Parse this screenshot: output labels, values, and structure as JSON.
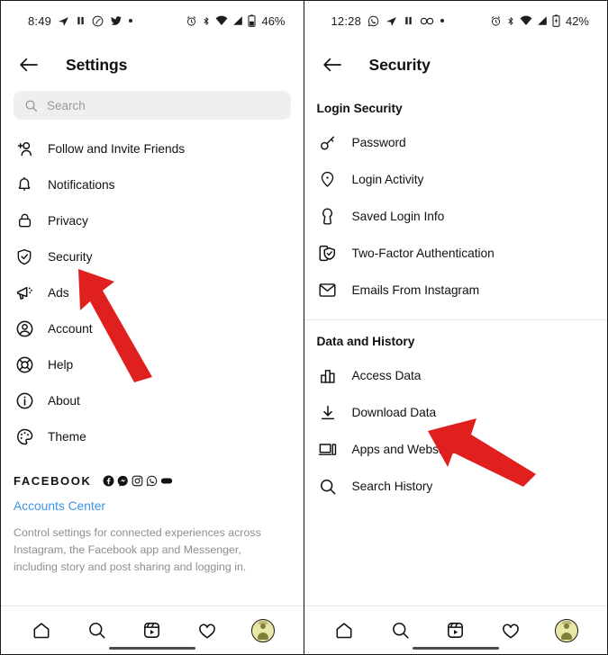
{
  "left_panel": {
    "status_bar": {
      "time": "8:49",
      "battery_percent": "46%",
      "left_icons": [
        "telegram-icon",
        "pause-icon",
        "spotify-icon",
        "twitter-icon",
        "more-dot-icon"
      ],
      "right_icons": [
        "alarm-icon",
        "bluetooth-icon",
        "wifi-icon",
        "signal-icon",
        "battery-icon"
      ]
    },
    "header": {
      "back_icon": "back-arrow-icon",
      "title": "Settings"
    },
    "search": {
      "icon": "search-icon",
      "placeholder": "Search",
      "value": ""
    },
    "items": [
      {
        "icon": "person-add-icon",
        "label": "Follow and Invite Friends"
      },
      {
        "icon": "bell-icon",
        "label": "Notifications"
      },
      {
        "icon": "lock-icon",
        "label": "Privacy"
      },
      {
        "icon": "shield-check-icon",
        "label": "Security"
      },
      {
        "icon": "megaphone-icon",
        "label": "Ads"
      },
      {
        "icon": "account-circle-icon",
        "label": "Account"
      },
      {
        "icon": "lifebuoy-icon",
        "label": "Help"
      },
      {
        "icon": "info-circle-icon",
        "label": "About"
      },
      {
        "icon": "palette-icon",
        "label": "Theme"
      }
    ],
    "facebook_block": {
      "brand": "FACEBOOK",
      "brand_icons": [
        "facebook-icon",
        "messenger-icon",
        "instagram-icon",
        "whatsapp-icon",
        "portal-icon"
      ],
      "link": "Accounts Center",
      "link_color": "#3f93e8",
      "description": "Control settings for connected experiences across Instagram, the Facebook app and Messenger, including story and post sharing and logging in."
    },
    "bottom_nav": [
      {
        "icon": "home-icon",
        "label": "Home"
      },
      {
        "icon": "search-icon",
        "label": "Search"
      },
      {
        "icon": "reels-icon",
        "label": "Reels"
      },
      {
        "icon": "heart-icon",
        "label": "Activity"
      },
      {
        "icon": "avatar-icon",
        "label": "Profile"
      }
    ]
  },
  "right_panel": {
    "status_bar": {
      "time": "12:28",
      "battery_percent": "42%",
      "left_icons": [
        "whatsapp-icon",
        "telegram-icon",
        "pause-icon",
        "infinity-icon",
        "more-dot-icon"
      ],
      "right_icons": [
        "alarm-icon",
        "bluetooth-icon",
        "wifi-icon",
        "signal-icon",
        "battery-charging-icon"
      ]
    },
    "header": {
      "back_icon": "back-arrow-icon",
      "title": "Security"
    },
    "sections": [
      {
        "title": "Login Security",
        "items": [
          {
            "icon": "key-icon",
            "label": "Password"
          },
          {
            "icon": "pin-icon",
            "label": "Login Activity"
          },
          {
            "icon": "keyhole-icon",
            "label": "Saved Login Info"
          },
          {
            "icon": "two-factor-icon",
            "label": "Two-Factor Authentication"
          },
          {
            "icon": "envelope-icon",
            "label": "Emails From Instagram"
          }
        ]
      },
      {
        "title": "Data and History",
        "items": [
          {
            "icon": "bar-chart-icon",
            "label": "Access Data"
          },
          {
            "icon": "download-icon",
            "label": "Download Data"
          },
          {
            "icon": "devices-icon",
            "label": "Apps and Websites"
          },
          {
            "icon": "search-icon",
            "label": "Search History"
          }
        ]
      }
    ],
    "bottom_nav": [
      {
        "icon": "home-icon",
        "label": "Home"
      },
      {
        "icon": "search-icon",
        "label": "Search"
      },
      {
        "icon": "reels-icon",
        "label": "Reels"
      },
      {
        "icon": "heart-icon",
        "label": "Activity"
      },
      {
        "icon": "avatar-icon",
        "label": "Profile"
      }
    ]
  },
  "annotations": [
    {
      "name": "arrow-to-security",
      "icon": "red-arrow-up-left",
      "color": "#E01F1F",
      "points_to": "Security"
    },
    {
      "name": "arrow-to-download-data",
      "icon": "red-arrow-up-left",
      "color": "#E01F1F",
      "points_to": "Download Data"
    }
  ]
}
